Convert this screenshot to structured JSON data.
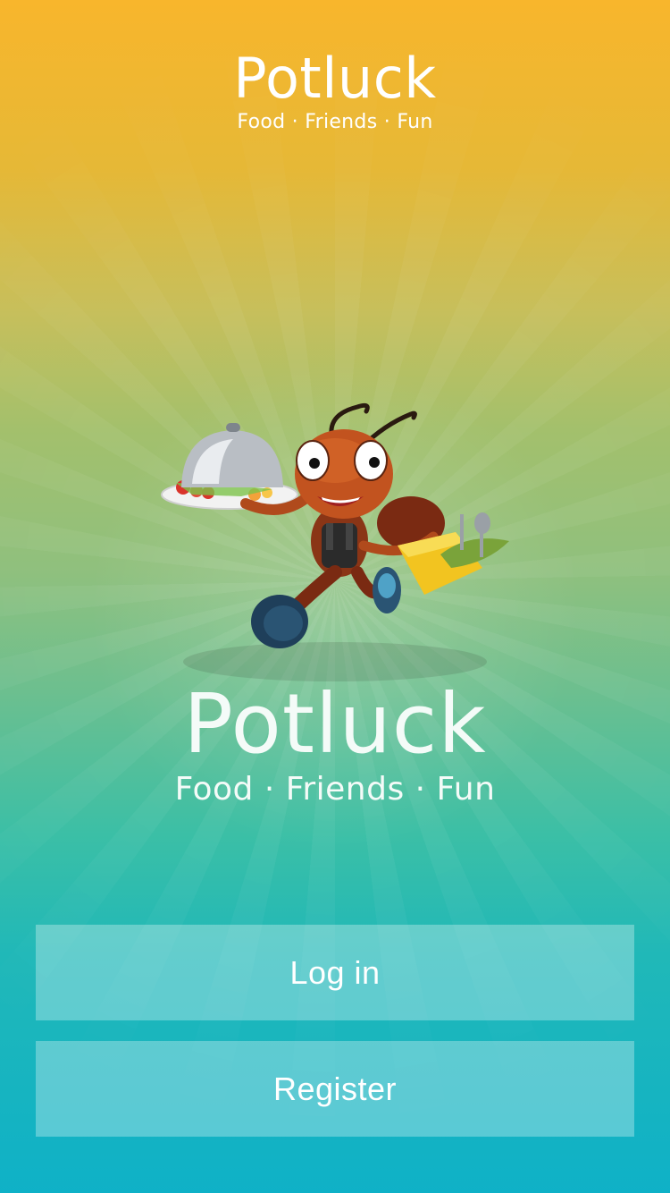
{
  "header": {
    "title": "Potluck",
    "tagline": "Food · Friends · Fun"
  },
  "hero": {
    "mascot_icon": "ant-waiter-mascot-icon"
  },
  "brand": {
    "title": "Potluck",
    "tagline": "Food · Friends · Fun"
  },
  "actions": {
    "login_label": "Log in",
    "register_label": "Register"
  },
  "colors": {
    "gradient_top": "#f8b62c",
    "gradient_middle": "#8fc07e",
    "gradient_bottom": "#0fb1c7",
    "text": "#ffffff"
  }
}
